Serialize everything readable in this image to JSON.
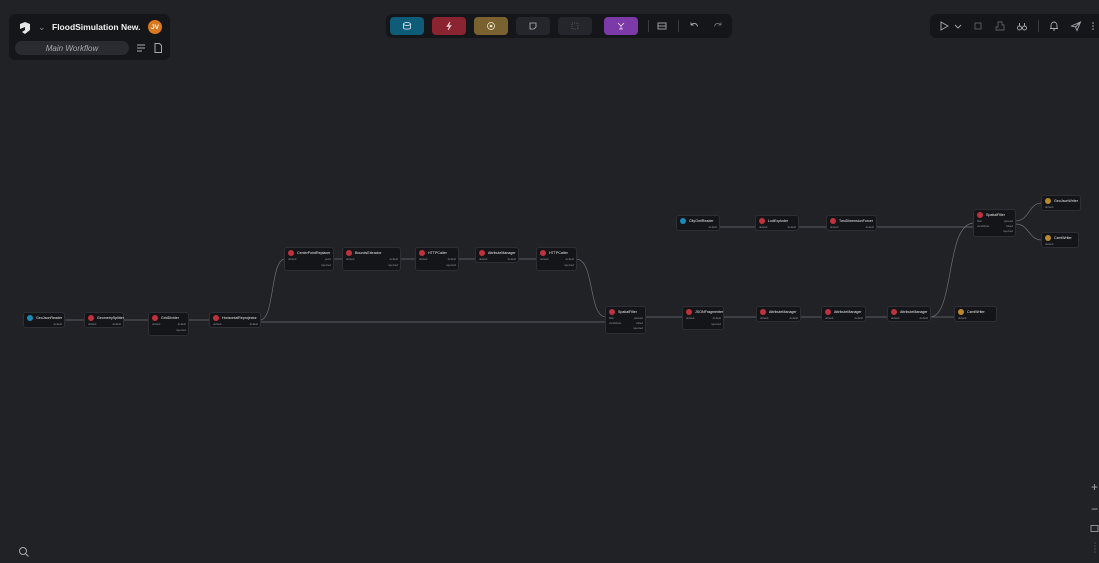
{
  "colors": {
    "reader": "#1a8bb8",
    "transformer": "#c0313e",
    "writer": "#b88a2c",
    "edge": "#6f7076",
    "btn_reader": "#0f5c78",
    "btn_transformer": "#8a2430",
    "btn_writer": "#7a6230",
    "btn_subworkflow": "#7b3aa8"
  },
  "project": {
    "logo_icon": "app-logo-icon",
    "title": "FloodSimulation New.",
    "avatar": "JV",
    "workflow": "Main Workflow"
  },
  "toolbar": {
    "buttons": [
      "reader-icon",
      "transformer-icon",
      "writer-icon",
      "note-icon",
      "batch-icon",
      "subworkflow-icon",
      "layout-icon",
      "undo-icon",
      "redo-icon"
    ]
  },
  "right_toolbar": {
    "buttons": [
      "play-icon",
      "chevron-down-icon",
      "stop-icon",
      "debug-icon",
      "binoculars-icon",
      "bell-icon",
      "share-icon"
    ]
  },
  "nodes": {
    "n1": {
      "title": "GeoJsonReader",
      "ports_out": [
        "default"
      ]
    },
    "n2": {
      "title": "GeometrySplitter",
      "ports_in": [
        "default"
      ],
      "ports_out": [
        "default"
      ]
    },
    "n3": {
      "title": "GridDivider",
      "ports_in": [
        "default"
      ],
      "ports_out": [
        "default",
        "rejected"
      ]
    },
    "n4": {
      "title": "HorizontalReprojector",
      "ports_in": [
        "default"
      ],
      "ports_out": [
        "default"
      ]
    },
    "n5": {
      "title": "CenterPointReplacer",
      "ports_in": [
        "default"
      ],
      "ports_out": [
        "point",
        "rejected"
      ]
    },
    "n6": {
      "title": "BoundsExtractor",
      "ports_in": [
        "default"
      ],
      "ports_out": [
        "default",
        "rejected"
      ]
    },
    "n7": {
      "title": "HTTPCaller",
      "ports_in": [
        "default"
      ],
      "ports_out": [
        "default",
        "rejected"
      ]
    },
    "n8": {
      "title": "AttributeManager",
      "ports_in": [
        "default"
      ],
      "ports_out": [
        "default"
      ]
    },
    "n9": {
      "title": "HTTPCaller",
      "ports_in": [
        "default"
      ],
      "ports_out": [
        "default",
        "rejected"
      ]
    },
    "n10": {
      "title": "SpatialFilter",
      "ports_in": [
        "filter",
        "candidate"
      ],
      "ports_out": [
        "passed",
        "failed",
        "rejected"
      ]
    },
    "n11": {
      "title": "JSONFragmenter",
      "ports_in": [
        "default"
      ],
      "ports_out": [
        "default",
        "rejected"
      ]
    },
    "n12": {
      "title": "AttributeManager",
      "ports_in": [
        "default"
      ],
      "ports_out": [
        "default"
      ]
    },
    "n13": {
      "title": "AttributeManager",
      "ports_in": [
        "default"
      ],
      "ports_out": [
        "default"
      ]
    },
    "n14": {
      "title": "AttributeManager",
      "ports_in": [
        "default"
      ],
      "ports_out": [
        "default"
      ]
    },
    "n15": {
      "title": "CzmlWriter",
      "ports_in": [
        "default"
      ]
    },
    "n16": {
      "title": "CityGmlReader",
      "ports_out": [
        "default"
      ]
    },
    "n17": {
      "title": "LodExploder",
      "ports_in": [
        "default"
      ],
      "ports_out": [
        "default"
      ]
    },
    "n18": {
      "title": "TwoDimensionForcer",
      "ports_in": [
        "default"
      ],
      "ports_out": [
        "default"
      ]
    },
    "n19": {
      "title": "SpatialFilter",
      "ports_in": [
        "filter",
        "candidate"
      ],
      "ports_out": [
        "passed",
        "failed",
        "rejected"
      ]
    },
    "n20": {
      "title": "GeoJsonWriter",
      "ports_in": [
        "default"
      ]
    },
    "n21": {
      "title": "CzmlWriter",
      "ports_in": [
        "default"
      ]
    }
  },
  "bottom_left": {
    "search_icon": "search-icon"
  },
  "bottom_right": {
    "zoom_in": "+",
    "zoom_out": "−",
    "fit_icon": "fit-view-icon",
    "minimap_icon": "minimap-icon"
  }
}
